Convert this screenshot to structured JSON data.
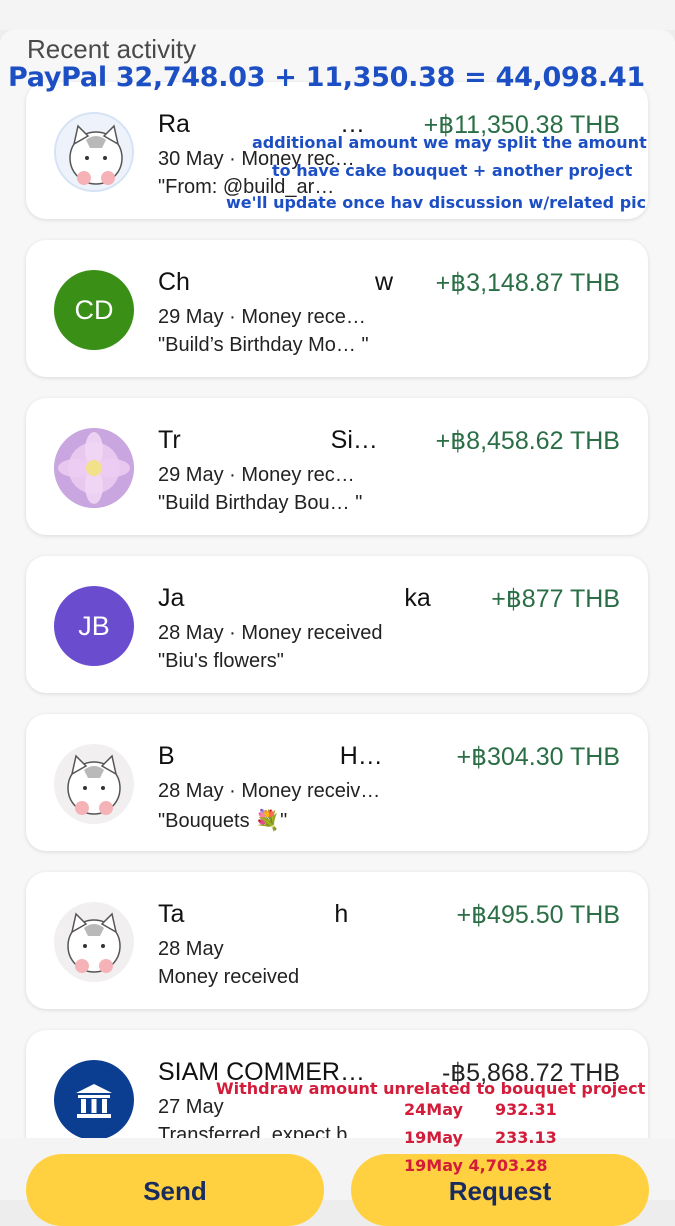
{
  "header": {
    "title": "Recent activity",
    "paypal_sum": "PayPal 32,748.03 + 11,350.38 = 44,098.41"
  },
  "transactions": [
    {
      "name": "Ra",
      "name_tail": "…",
      "amount": "+฿11,350.38 THB",
      "line2": "30 May · Money rec…",
      "line3": "\"From: @build_ar…",
      "avatar": "cat-sticker-icon"
    },
    {
      "name": "Ch",
      "name_tail": "w",
      "amount": "+฿3,148.87 THB",
      "line2": "29 May · Money rece…",
      "line3": "\"Build’s Birthday Mo… \"",
      "avatar_initials": "CD",
      "avatar_color": "#3a8f17"
    },
    {
      "name": "Tr",
      "name_tail": "Si…",
      "amount": "+฿8,458.62 THB",
      "line2": "29 May · Money rec…",
      "line3": "\"Build Birthday Bou… \"",
      "avatar": "lotus-photo-icon"
    },
    {
      "name": "Ja",
      "name_tail": "ka",
      "amount": "+฿877 THB",
      "line2": "28 May · Money received",
      "line3": "\"Biu's flowers\"",
      "avatar_initials": "JB",
      "avatar_color": "#6a4cce"
    },
    {
      "name": "B",
      "name_tail": "H…",
      "amount": "+฿304.30 THB",
      "line2": "28 May · Money receiv…",
      "line3": "\"Bouquets 💐\"",
      "avatar": "cat-sticker-icon"
    },
    {
      "name": "Ta",
      "name_tail": "h",
      "amount": "+฿495.50 THB",
      "line2": "28 May",
      "line3": "Money received",
      "avatar": "cat-sticker-icon"
    },
    {
      "name": "SIAM COMMER…",
      "name_tail": "",
      "amount": "-฿5,868.72 THB",
      "line2": "27 May",
      "line3": "Transferred, expect b…",
      "avatar": "bank-icon",
      "avatar_color": "#0b3e91"
    }
  ],
  "notes": {
    "blue1": "additional amount we may split the amount",
    "blue2": "to have cake bouquet + another project",
    "blue3": "we'll update once hav discussion w/related pic",
    "red1": "Withdraw amount unrelated to bouquet project",
    "red2_date": "24May",
    "red2_val": "932.31",
    "red3_date": "19May",
    "red3_val": "233.13",
    "red4": "19May 4,703.28"
  },
  "buttons": {
    "send": "Send",
    "request": "Request"
  },
  "colors": {
    "positive": "#2a6e45",
    "accent": "#ffd140",
    "annotation_blue": "#1d4fc4",
    "annotation_red": "#d31b3a"
  }
}
